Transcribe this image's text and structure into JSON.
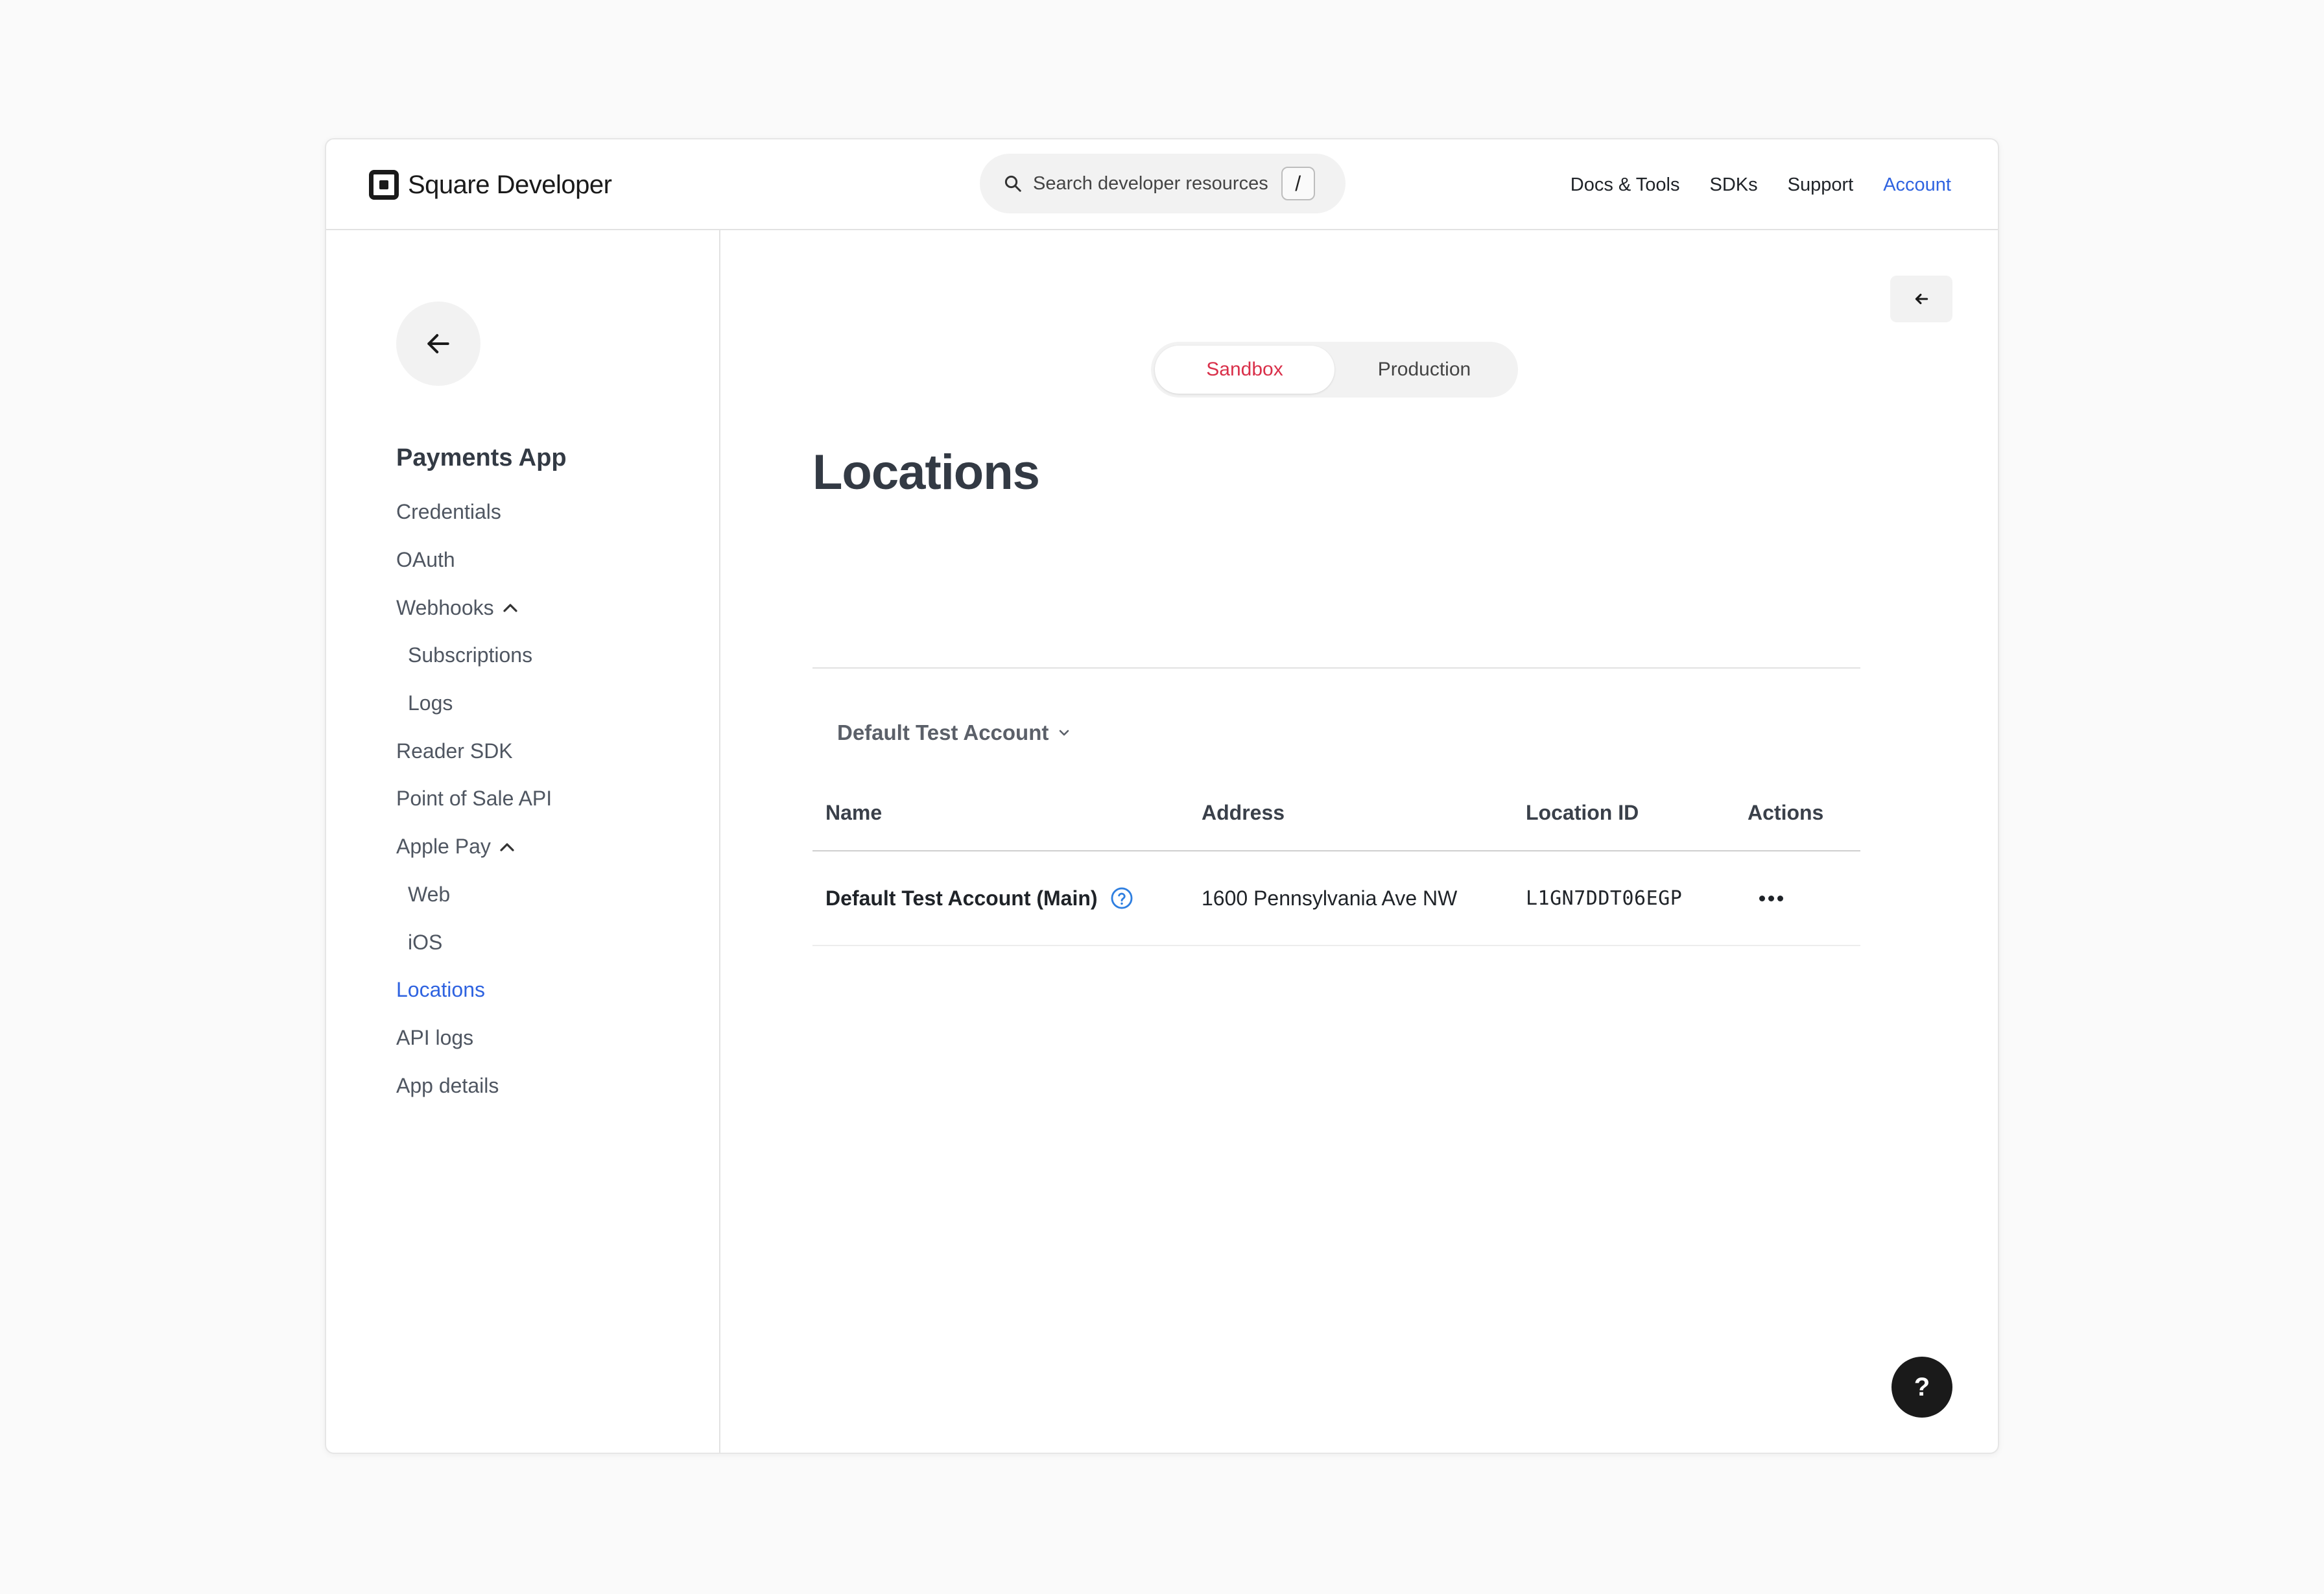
{
  "header": {
    "brand": "Square Developer",
    "search_placeholder": "Search developer resources",
    "search_shortcut": "/",
    "nav": [
      {
        "label": "Docs & Tools"
      },
      {
        "label": "SDKs"
      },
      {
        "label": "Support"
      },
      {
        "label": "Account"
      }
    ],
    "active_color": "#2f63e0"
  },
  "sidebar": {
    "app_title": "Payments App",
    "items": [
      {
        "label": "Credentials"
      },
      {
        "label": "OAuth"
      },
      {
        "label": "Webhooks",
        "expanded": true
      },
      {
        "label": "Subscriptions"
      },
      {
        "label": "Logs"
      },
      {
        "label": "Reader SDK"
      },
      {
        "label": "Point of Sale API"
      },
      {
        "label": "Apple Pay",
        "expanded": true
      },
      {
        "label": "Web"
      },
      {
        "label": "iOS"
      },
      {
        "label": "Locations",
        "active": true
      },
      {
        "label": "API logs"
      },
      {
        "label": "App details"
      }
    ]
  },
  "main": {
    "env_tabs": [
      {
        "label": "Sandbox",
        "selected": true
      },
      {
        "label": "Production"
      }
    ],
    "title": "Locations",
    "account_select": "Default Test Account",
    "table": {
      "columns": [
        "Name",
        "Address",
        "Location ID",
        "Actions"
      ],
      "rows": [
        {
          "name": "Default Test Account (Main)",
          "address": "1600 Pennsylvania Ave NW",
          "location_id": "L1GN7DDT06EGP"
        }
      ]
    },
    "help_fab": "?"
  },
  "colors": {
    "sandbox": "#d9304a",
    "link": "#2f63e0"
  }
}
